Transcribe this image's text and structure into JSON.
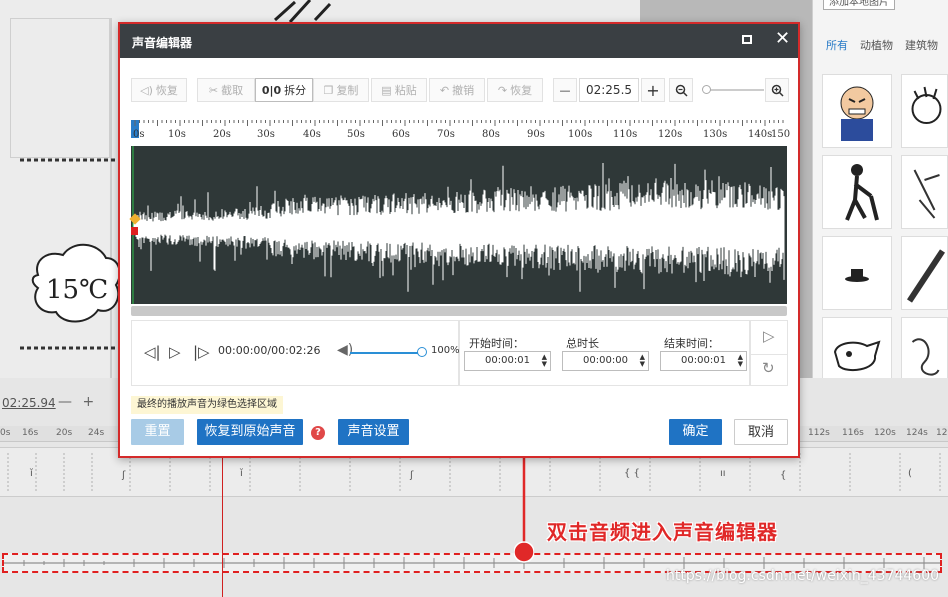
{
  "background": {
    "add_local_image": "添加本地图片",
    "categories": [
      {
        "label": "所有",
        "active": true
      },
      {
        "label": "动植物",
        "active": false
      },
      {
        "label": "建筑物",
        "active": false
      }
    ],
    "sticker_text": "15℃",
    "time_label": "02:25.94",
    "time_minus": "—",
    "time_plus": "+",
    "ruler": [
      "0s",
      "16s",
      "20s",
      "24s",
      "112s",
      "116s",
      "120s",
      "124s",
      "12"
    ],
    "annotation": "双击音频进入声音编辑器",
    "watermark": "https://blog.csdn.net/weixin_43744600"
  },
  "dialog": {
    "title": "声音编辑器",
    "toolbar": {
      "restore_left": "恢复",
      "cut": "截取",
      "split": "拆分",
      "copy": "复制",
      "paste": "粘贴",
      "undo": "撤销",
      "redo": "恢复",
      "minus": "—",
      "time_value": "02:25.5",
      "plus": "+"
    },
    "ruler_labels": [
      "0s",
      "10s",
      "20s",
      "30s",
      "40s",
      "50s",
      "60s",
      "70s",
      "80s",
      "90s",
      "100s",
      "110s",
      "120s",
      "130s",
      "140s",
      "150"
    ],
    "player": {
      "time_readout": "00:00:00/00:02:26",
      "volume_pct": "100%"
    },
    "time_fields": {
      "start_label": "开始时间：",
      "start_value": "00:00:01",
      "duration_label": "总时长",
      "duration_value": "00:00:00",
      "end_label": "结束时间：",
      "end_value": "00:00:01"
    },
    "hint": "最终的播放声音为绿色选择区域",
    "buttons": {
      "reset": "重置",
      "restore_original": "恢复到原始声音",
      "help": "?",
      "sound_settings": "声音设置",
      "ok": "确定",
      "cancel": "取消"
    }
  }
}
